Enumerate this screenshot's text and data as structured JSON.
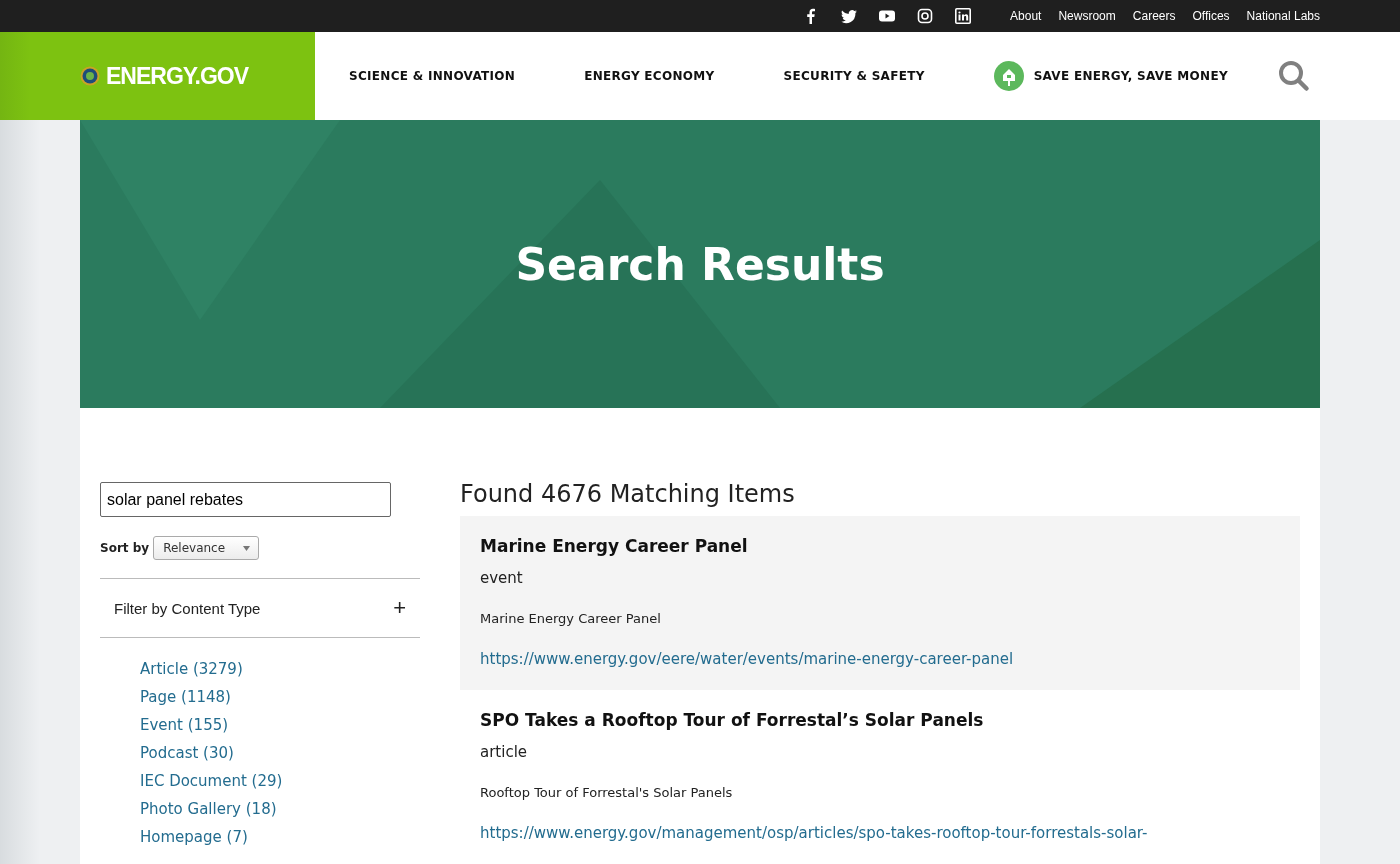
{
  "top_links": [
    "About",
    "Newsroom",
    "Careers",
    "Offices",
    "National Labs"
  ],
  "social": [
    {
      "kind": "facebook"
    },
    {
      "kind": "twitter"
    },
    {
      "kind": "youtube"
    },
    {
      "kind": "instagram"
    },
    {
      "kind": "linkedin"
    }
  ],
  "logo": "ENERGY.GOV",
  "nav": [
    {
      "label": "SCIENCE & INNOVATION",
      "kind": "plain"
    },
    {
      "label": "ENERGY ECONOMY",
      "kind": "plain"
    },
    {
      "label": "SECURITY & SAFETY",
      "kind": "plain"
    },
    {
      "label": "SAVE ENERGY, SAVE MONEY",
      "kind": "house"
    }
  ],
  "hero_title": "Search Results",
  "search": {
    "value": "solar panel rebates"
  },
  "sort": {
    "label": "Sort by",
    "value": "Relevance"
  },
  "filter": {
    "title": "Filter by Content Type",
    "toggle": "+",
    "items": [
      "Article (3279)",
      "Page (1148)",
      "Event (155)",
      "Podcast (30)",
      "IEC Document (29)",
      "Photo Gallery (18)",
      "Homepage (7)"
    ]
  },
  "results_heading": "Found 4676 Matching Items",
  "results": [
    {
      "title": "Marine Energy Career Panel",
      "type": "event",
      "summary": "Marine Energy Career Panel",
      "url": "https://www.energy.gov/eere/water/events/marine-energy-career-panel",
      "kind": "highlighted"
    },
    {
      "title": "SPO Takes a Rooftop Tour of Forrestal’s Solar Panels",
      "type": "article",
      "summary": "Rooftop Tour of Forrestal's Solar Panels",
      "url": "https://www.energy.gov/management/osp/articles/spo-takes-rooftop-tour-forrestals-solar-",
      "kind": "plain"
    }
  ]
}
